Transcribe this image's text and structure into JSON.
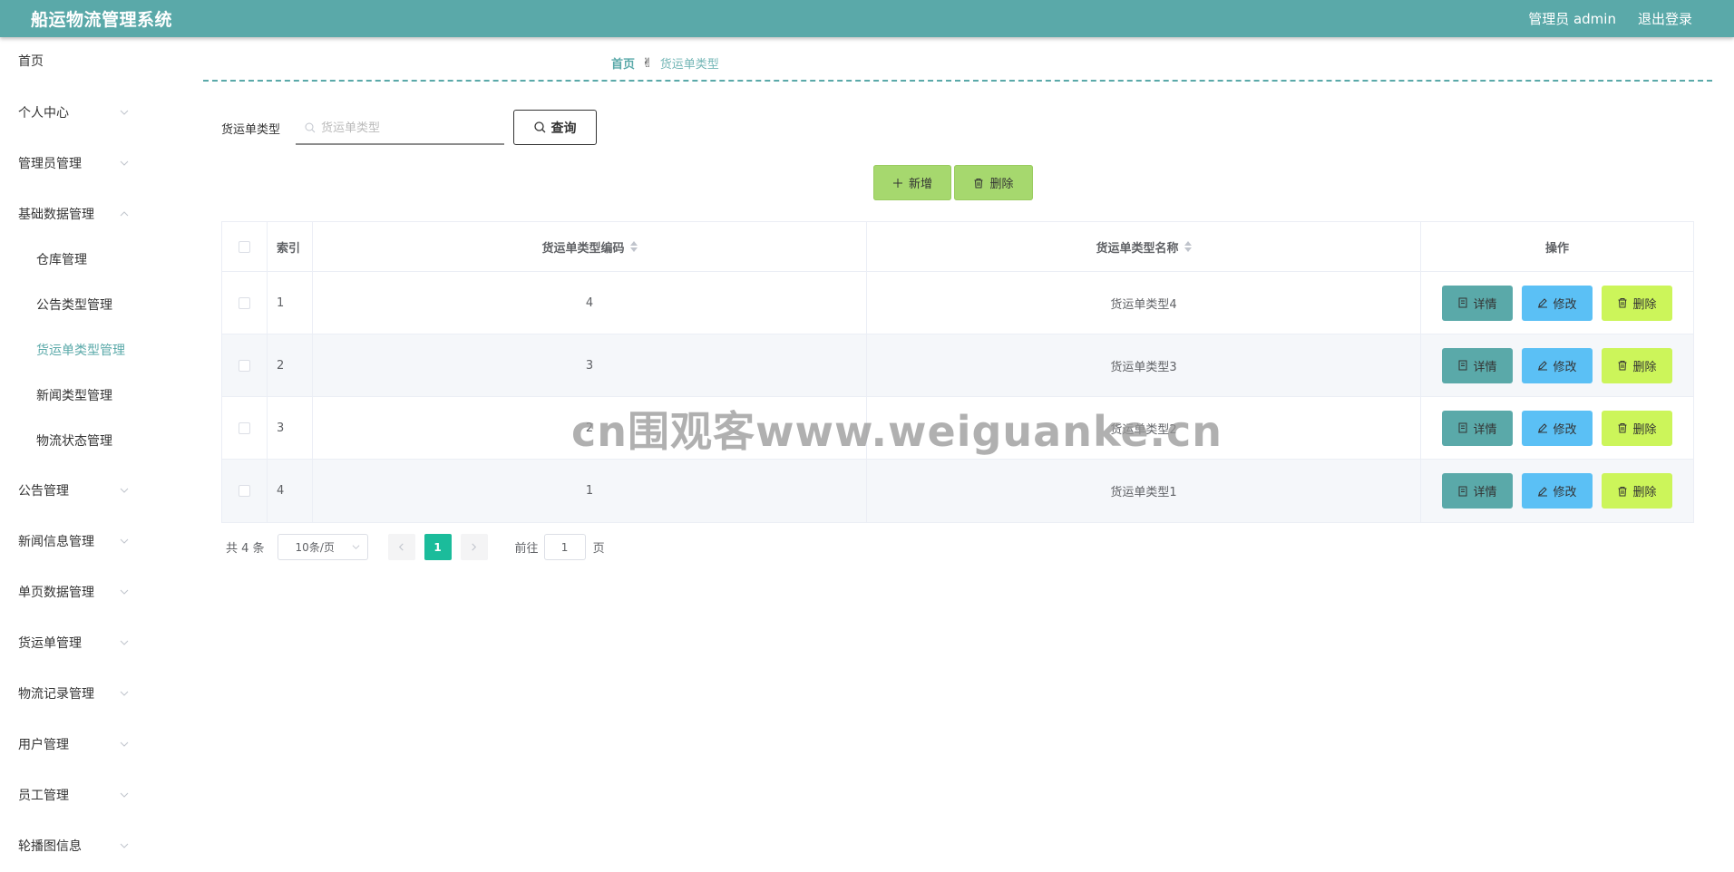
{
  "header": {
    "title": "船运物流管理系统",
    "user": "管理员 admin",
    "logout": "退出登录",
    "color": "#5aa9a9"
  },
  "sidebar": {
    "items": [
      {
        "label": "首页",
        "expandable": false
      },
      {
        "label": "个人中心",
        "expandable": true,
        "expanded": false
      },
      {
        "label": "管理员管理",
        "expandable": true,
        "expanded": false
      },
      {
        "label": "基础数据管理",
        "expandable": true,
        "expanded": true,
        "children": [
          {
            "label": "仓库管理"
          },
          {
            "label": "公告类型管理"
          },
          {
            "label": "货运单类型管理",
            "active": true
          },
          {
            "label": "新闻类型管理"
          },
          {
            "label": "物流状态管理"
          }
        ]
      },
      {
        "label": "公告管理",
        "expandable": true,
        "expanded": false
      },
      {
        "label": "新闻信息管理",
        "expandable": true,
        "expanded": false
      },
      {
        "label": "单页数据管理",
        "expandable": true,
        "expanded": false
      },
      {
        "label": "货运单管理",
        "expandable": true,
        "expanded": false
      },
      {
        "label": "物流记录管理",
        "expandable": true,
        "expanded": false
      },
      {
        "label": "用户管理",
        "expandable": true,
        "expanded": false
      },
      {
        "label": "员工管理",
        "expandable": true,
        "expanded": false
      },
      {
        "label": "轮播图信息",
        "expandable": true,
        "expanded": false
      }
    ]
  },
  "breadcrumb": {
    "home": "首页",
    "current": "货运单类型"
  },
  "search": {
    "label": "货运单类型",
    "placeholder": "货运单类型",
    "value": "",
    "query_label": "查询"
  },
  "actions": {
    "add_label": "新增",
    "delete_label": "删除"
  },
  "table": {
    "columns": [
      "索引",
      "货运单类型编码",
      "货运单类型名称",
      "操作"
    ],
    "rows": [
      {
        "index": "1",
        "code": "4",
        "name": "货运单类型4"
      },
      {
        "index": "2",
        "code": "3",
        "name": "货运单类型3"
      },
      {
        "index": "3",
        "code": "2",
        "name": "货运单类型2"
      },
      {
        "index": "4",
        "code": "1",
        "name": "货运单类型1"
      }
    ],
    "row_actions": {
      "detail": "详情",
      "edit": "修改",
      "delete": "删除"
    }
  },
  "pagination": {
    "total": "共 4 条",
    "page_size": "10条/页",
    "current_page": "1",
    "goto_label": "前往",
    "goto_value": "1",
    "page_unit": "页"
  },
  "watermark": "cn围观客www.weiguanke.cn"
}
